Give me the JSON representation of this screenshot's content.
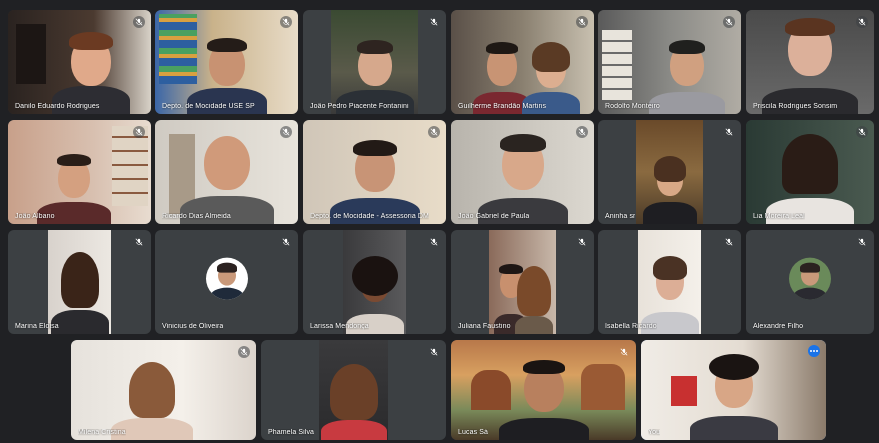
{
  "participants": [
    {
      "name": "Danilo Eduardo Rodrigues",
      "muted": true
    },
    {
      "name": "Depto. de Mocidade USE SP",
      "muted": true
    },
    {
      "name": "João Pedro Piacente Fontanini",
      "muted": true
    },
    {
      "name": "Guilherme Brandão Martins",
      "muted": true
    },
    {
      "name": "Rodolfo Monteiro",
      "muted": true
    },
    {
      "name": "Priscila Rodrigues Sonsim",
      "muted": true
    },
    {
      "name": "João Albano",
      "muted": true
    },
    {
      "name": "Ricardo Dias Almeida",
      "muted": true
    },
    {
      "name": "Depto. de Mocidade - Assessoria DM",
      "muted": true
    },
    {
      "name": "João Gabriel de Paula",
      "muted": true
    },
    {
      "name": "Aninha sr",
      "muted": true
    },
    {
      "name": "Lia Moreira Leal",
      "muted": true
    },
    {
      "name": "Marina Eloisa",
      "muted": true
    },
    {
      "name": "Vinicius de Oliveira",
      "muted": true
    },
    {
      "name": "Larissa Mendonça",
      "muted": true
    },
    {
      "name": "Juliana Faustino",
      "muted": true
    },
    {
      "name": "Isabella Ricardo",
      "muted": true
    },
    {
      "name": "Alexandre Filho",
      "muted": true
    },
    {
      "name": "Milena Cristina",
      "muted": true
    },
    {
      "name": "Phamela Silva",
      "muted": true
    },
    {
      "name": "Lucas Sá",
      "muted": true
    },
    {
      "name": "You",
      "muted": false
    }
  ],
  "colors": {
    "background": "#202124",
    "tile": "#3c4043",
    "active_border": "#8ab4f8",
    "more_button": "#1a73e8"
  }
}
